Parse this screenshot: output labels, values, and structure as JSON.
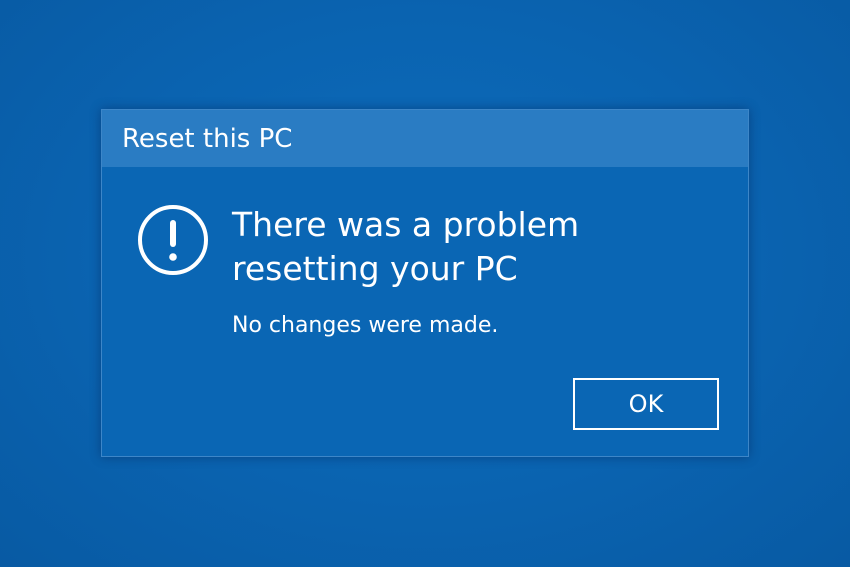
{
  "dialog": {
    "title": "Reset this PC",
    "icon": "exclamation-circle-icon",
    "heading": "There was a problem resetting your PC",
    "detail": "No changes were made.",
    "ok_label": "OK"
  },
  "colors": {
    "background": "#0a63b0",
    "dialog_body": "#0a66b4",
    "titlebar": "#2a7cc3",
    "text": "#ffffff"
  }
}
